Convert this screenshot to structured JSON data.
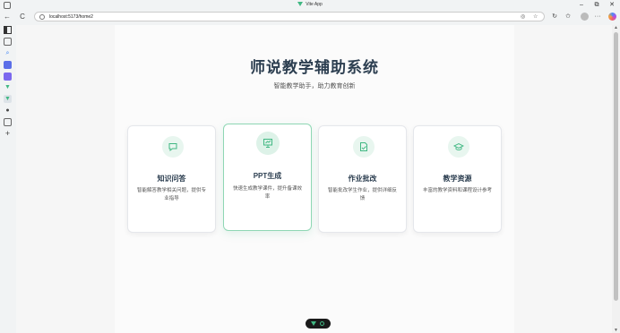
{
  "window": {
    "title": "Vite App",
    "minimize": "–",
    "maximize": "⧉",
    "close": "✕"
  },
  "toolbar": {
    "back": "←",
    "reload": "C",
    "url": "localhost:5173/home2",
    "more": "···"
  },
  "page": {
    "title": "师说教学辅助系统",
    "subtitle": "智能教学助手，助力教育创新"
  },
  "cards": [
    {
      "title": "知识问答",
      "description": "智能解答教学相关问题，提供专业指导",
      "icon": "chat-bubble-icon"
    },
    {
      "title": "PPT生成",
      "description": "快速生成教学课件，提升备课效率",
      "icon": "presentation-icon"
    },
    {
      "title": "作业批改",
      "description": "智能批改学生作业，提供详细反馈",
      "icon": "document-check-icon"
    },
    {
      "title": "教学资源",
      "description": "丰富的教学资料和课程设计参考",
      "icon": "graduation-cap-icon"
    }
  ],
  "colors": {
    "accent": "#41b883",
    "title": "#2c3e50"
  }
}
